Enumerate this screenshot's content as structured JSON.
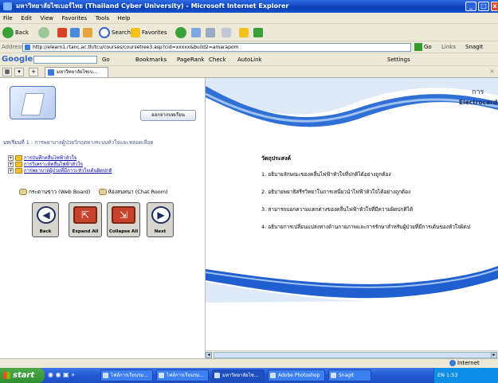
{
  "window": {
    "title": "มหาวิทยาลัยไซเบอร์ไทย (Thailand Cyber University) - Microsoft Internet Explorer",
    "controls": {
      "minimize": "_",
      "maximize": "□",
      "close": "x"
    }
  },
  "menu": [
    "File",
    "Edit",
    "View",
    "Favorites",
    "Tools",
    "Help"
  ],
  "toolbar": {
    "back": "Back",
    "search": "Search",
    "favorites": "Favorites"
  },
  "address": {
    "label": "Address",
    "url": "http://elearn1.rtanc.ac.th/tcu/courses/coursetree3.asp?cid=xxxxx&build2=amarapom",
    "go": "Go",
    "links": "Links",
    "snagit": "SnagIt"
  },
  "googlebar": {
    "logo": "Google",
    "go": "Go",
    "bookmarks": "Bookmarks",
    "pagerank": "PageRank",
    "check": "Check",
    "autolink": "AutoLink",
    "settings": "Settings"
  },
  "tabs": {
    "active": "มหาวิทยาลัยไซเบ..."
  },
  "left": {
    "home_button": "ออกจากบทเรียน",
    "lesson_label": "บทเรียนที่ 1",
    "lesson_title": ": การพยาบาลผู้ป่วยวิกฤตทางระบบหัวใจและหลอดเลือด",
    "tree": [
      "การบันทึกคลื่นไฟฟ้าหัวใจ",
      "การวิเคราะห์คลื่นไฟฟ้าหัวใจ",
      "การพยาบาลผู้ป่วยที่มีภาวะหัวใจเต้นผิดปกติ"
    ],
    "webboard": "กระดานข่าว (Web Board)",
    "chatroom": "ห้องสนทนา (Chat Room)",
    "nav_buttons": [
      {
        "name": "back",
        "label": "Back",
        "glyph": "◀"
      },
      {
        "name": "expand-all",
        "label": "Expand All",
        "glyph": "⇱"
      },
      {
        "name": "collapse-all",
        "label": "Collapse All",
        "glyph": "⇲"
      },
      {
        "name": "next",
        "label": "Next",
        "glyph": "▶"
      }
    ]
  },
  "right": {
    "header_title": "การ",
    "header_subtitle": "Electrocardio",
    "objectives_heading": "วัตถุประสงค์",
    "objectives": [
      "1. อธิบายลักษณะของคลื่นไฟฟ้าหัวใจที่ปกติได้อย่างถูกต้อง",
      "2. อธิบายพยาธิสรีรวิทยาในการเหนี่ยวนำไฟฟ้าหัวใจได้อย่างถูกต้อง",
      "3. สามารถบอกความแตกต่างของคลื่นไฟฟ้าหัวใจที่มีความผิดปกติได้",
      "4. อธิบายการเปลี่ยนแปลงทางด้านกายภาพและการรักษาสำหรับผู้ป่วยที่มีการเต้นของหัวใจผิดป"
    ]
  },
  "status": {
    "zone": "Internet"
  },
  "taskbar": {
    "start": "start",
    "tasks": [
      "ไฟล์การเรียนรม...",
      "ไฟล์การเรียนรม...",
      "มหาวิทยาลัยไซ...",
      "Adobe Photoshop",
      "SnagIt"
    ],
    "tray": "EN  1:53"
  },
  "colors": {
    "titlebar": "#0a3fb5",
    "taskbar": "#2357d3",
    "start": "#2f8f2f",
    "header_blue": "#1b2c60"
  }
}
